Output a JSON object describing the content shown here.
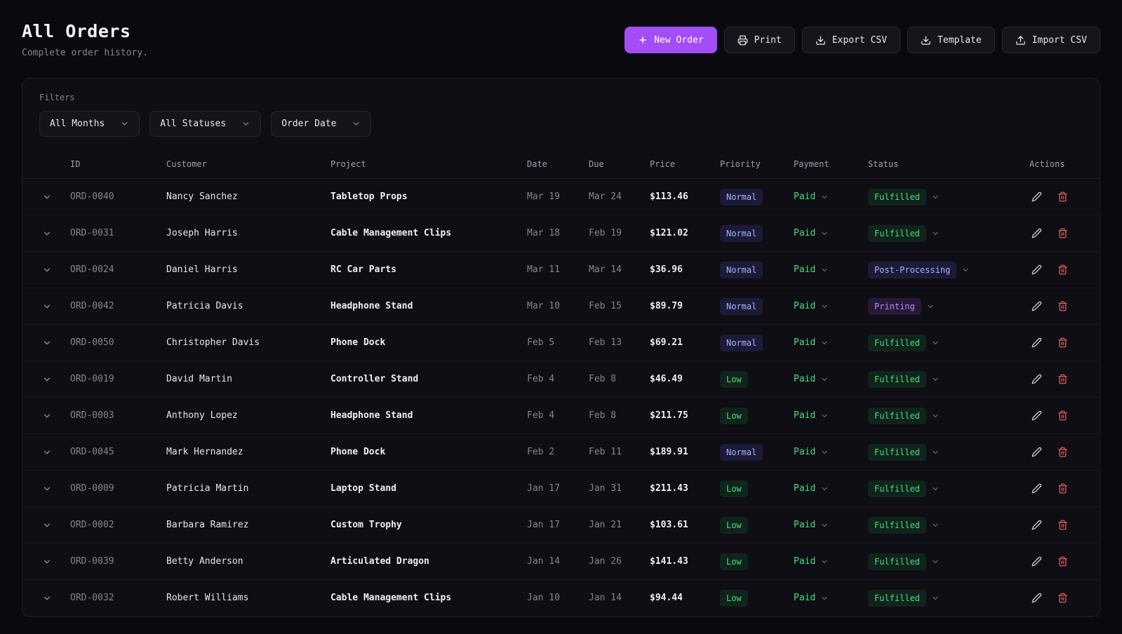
{
  "header": {
    "title": "All Orders",
    "subtitle": "Complete order history."
  },
  "toolbar": {
    "new_order_label": "New Order",
    "print_label": "Print",
    "export_csv_label": "Export CSV",
    "template_label": "Template",
    "import_csv_label": "Import CSV"
  },
  "filters": {
    "section_label": "Filters",
    "month_filter_value": "All Months",
    "status_filter_value": "All Statuses",
    "sort_filter_value": "Order Date"
  },
  "table": {
    "headers": [
      "ID",
      "Customer",
      "Project",
      "Date",
      "Due",
      "Price",
      "Priority",
      "Payment",
      "Status",
      "Actions"
    ],
    "rows": [
      {
        "id": "ORD-0040",
        "customer": "Nancy Sanchez",
        "project": "Tabletop Props",
        "date": "Mar 19",
        "due": "Mar 24",
        "price": "$113.46",
        "priority": "Normal",
        "payment": "Paid",
        "status": "Fulfilled"
      },
      {
        "id": "ORD-0031",
        "customer": "Joseph Harris",
        "project": "Cable Management Clips",
        "date": "Mar 18",
        "due": "Feb 19",
        "price": "$121.02",
        "priority": "Normal",
        "payment": "Paid",
        "status": "Fulfilled"
      },
      {
        "id": "ORD-0024",
        "customer": "Daniel Harris",
        "project": "RC Car Parts",
        "date": "Mar 11",
        "due": "Mar 14",
        "price": "$36.96",
        "priority": "Normal",
        "payment": "Paid",
        "status": "Post-Processing"
      },
      {
        "id": "ORD-0042",
        "customer": "Patricia Davis",
        "project": "Headphone Stand",
        "date": "Mar 10",
        "due": "Feb 15",
        "price": "$89.79",
        "priority": "Normal",
        "payment": "Paid",
        "status": "Printing"
      },
      {
        "id": "ORD-0050",
        "customer": "Christopher Davis",
        "project": "Phone Dock",
        "date": "Feb 5",
        "due": "Feb 13",
        "price": "$69.21",
        "priority": "Normal",
        "payment": "Paid",
        "status": "Fulfilled"
      },
      {
        "id": "ORD-0019",
        "customer": "David Martin",
        "project": "Controller Stand",
        "date": "Feb 4",
        "due": "Feb 8",
        "price": "$46.49",
        "priority": "Low",
        "payment": "Paid",
        "status": "Fulfilled"
      },
      {
        "id": "ORD-0003",
        "customer": "Anthony Lopez",
        "project": "Headphone Stand",
        "date": "Feb 4",
        "due": "Feb 8",
        "price": "$211.75",
        "priority": "Low",
        "payment": "Paid",
        "status": "Fulfilled"
      },
      {
        "id": "ORD-0045",
        "customer": "Mark Hernandez",
        "project": "Phone Dock",
        "date": "Feb 2",
        "due": "Feb 11",
        "price": "$189.91",
        "priority": "Normal",
        "payment": "Paid",
        "status": "Fulfilled"
      },
      {
        "id": "ORD-0009",
        "customer": "Patricia Martin",
        "project": "Laptop Stand",
        "date": "Jan 17",
        "due": "Jan 31",
        "price": "$211.43",
        "priority": "Low",
        "payment": "Paid",
        "status": "Fulfilled"
      },
      {
        "id": "ORD-0002",
        "customer": "Barbara Ramirez",
        "project": "Custom Trophy",
        "date": "Jan 17",
        "due": "Jan 21",
        "price": "$103.61",
        "priority": "Low",
        "payment": "Paid",
        "status": "Fulfilled"
      },
      {
        "id": "ORD-0039",
        "customer": "Betty Anderson",
        "project": "Articulated Dragon",
        "date": "Jan 14",
        "due": "Jan 26",
        "price": "$141.43",
        "priority": "Low",
        "payment": "Paid",
        "status": "Fulfilled"
      },
      {
        "id": "ORD-0032",
        "customer": "Robert Williams",
        "project": "Cable Management Clips",
        "date": "Jan 10",
        "due": "Jan 14",
        "price": "$94.44",
        "priority": "Low",
        "payment": "Paid",
        "status": "Fulfilled"
      }
    ]
  },
  "icons": {
    "plus": "+",
    "printer": "⎙",
    "download": "⭳",
    "upload": "⭱",
    "chevron_down": "⌄",
    "edit": "✎",
    "trash": "🗑"
  },
  "colors": {
    "background": "#0a0a0e",
    "card": "#0e0e14",
    "accent_purple": "#a24df5",
    "green_status": "#4ade80",
    "indigo_badge": "#a5b4fc",
    "purple_badge": "#c084fc",
    "danger_red": "#e35d5d"
  }
}
